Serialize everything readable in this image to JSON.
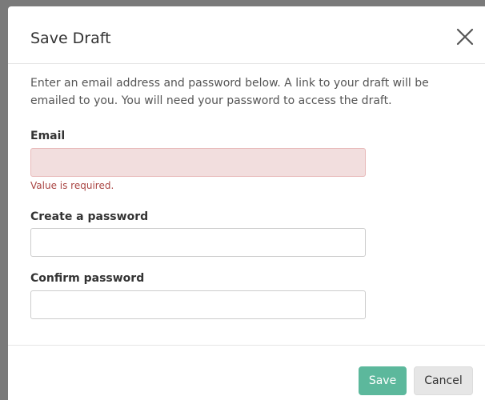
{
  "dialog": {
    "title": "Save Draft",
    "close_icon": "close-icon",
    "intro": "Enter an email address and password below. A link to your draft will be emailed to you. You will need your password to access the draft.",
    "fields": {
      "email": {
        "label": "Email",
        "value": "",
        "error": "Value is required."
      },
      "password": {
        "label": "Create a password",
        "value": ""
      },
      "confirm_password": {
        "label": "Confirm password",
        "value": ""
      }
    },
    "buttons": {
      "save": "Save",
      "cancel": "Cancel"
    }
  },
  "colors": {
    "accent": "#5cb89c",
    "error_bg": "#f2dede",
    "error_text": "#a94442"
  }
}
